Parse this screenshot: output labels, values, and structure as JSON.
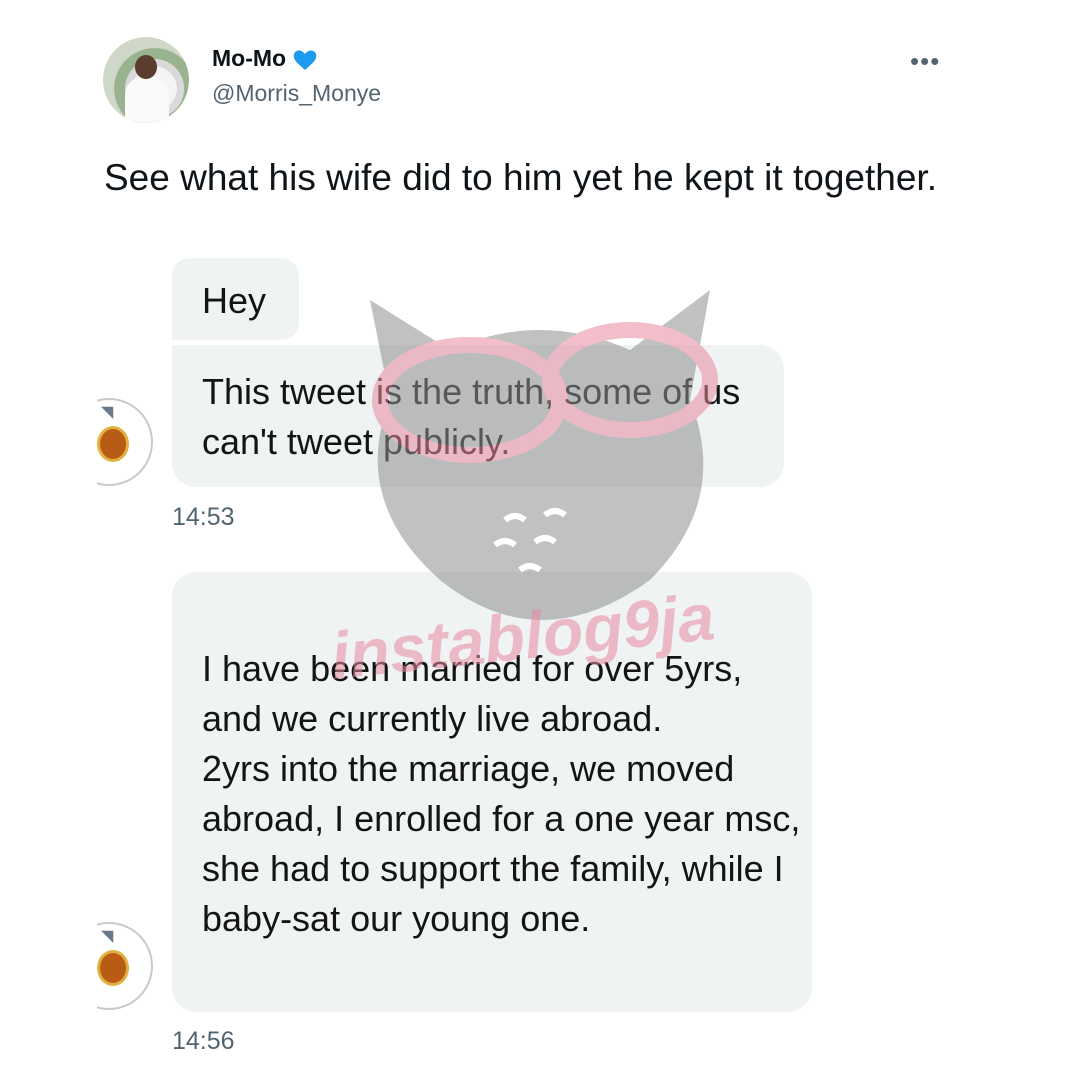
{
  "tweet": {
    "display_name": "Mo-Mo",
    "handle": "@Morris_Monye",
    "more_label": "•••",
    "text": "See what his wife did to him yet he kept it together."
  },
  "dm": {
    "messages": [
      {
        "text": "Hey"
      },
      {
        "text": "This tweet is the truth, some of us can't tweet publicly."
      },
      {
        "text": "I have been married for over 5yrs, and we currently live abroad.\n2yrs into the marriage, we moved abroad, I enrolled for a one year msc, she had to support the family, while I baby-sat our young one."
      }
    ],
    "timestamps": [
      "14:53",
      "14:56"
    ]
  },
  "watermark": {
    "text": "instablog9ja"
  },
  "colors": {
    "verified": "#1d9bf0",
    "bubble": "#eff3f4",
    "secondary_text": "#536471",
    "watermark_pink": "#e88a9f"
  },
  "icons": {
    "verified": "verified-badge-icon",
    "more": "more-options-icon"
  }
}
